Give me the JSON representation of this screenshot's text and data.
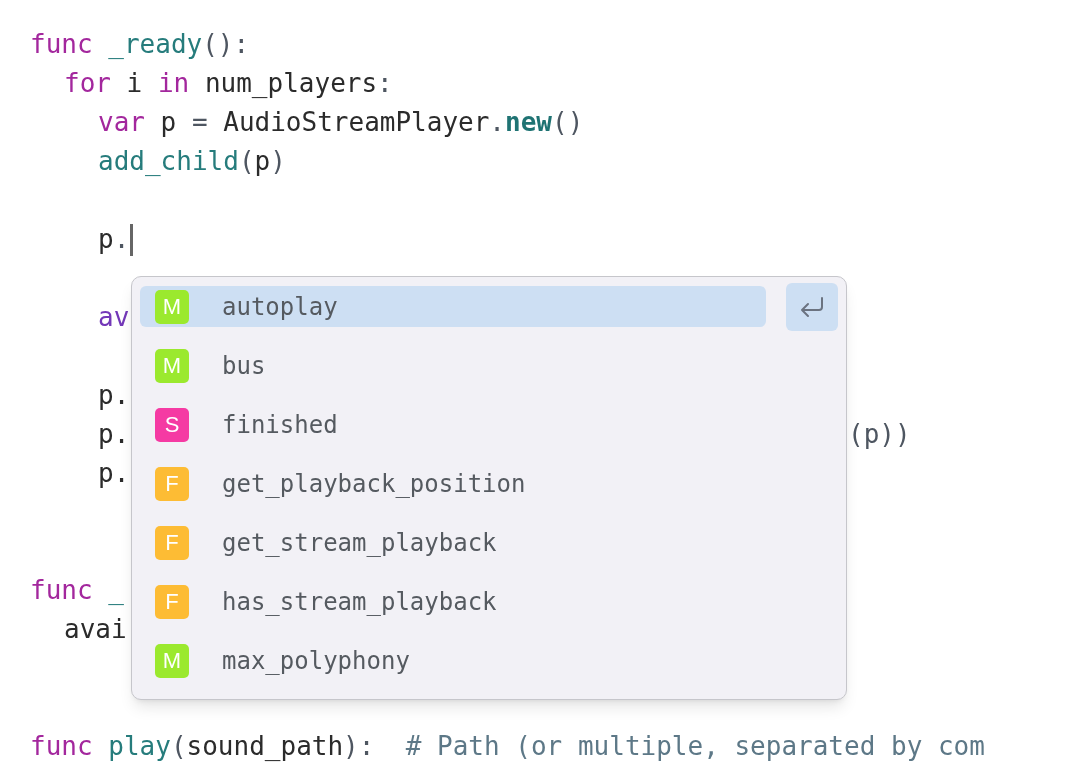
{
  "code_lines": [
    {
      "tokens": [
        {
          "kind": "keyword",
          "text": "func"
        },
        {
          "kind": "function",
          "text": " _ready"
        },
        {
          "kind": "punct",
          "text": "():"
        }
      ],
      "children": [
        {
          "tokens": [
            {
              "kind": "keyword",
              "text": "for"
            },
            {
              "kind": "plain",
              "text": " i "
            },
            {
              "kind": "keyword",
              "text": "in"
            },
            {
              "kind": "plain",
              "text": " num_players"
            },
            {
              "kind": "punct",
              "text": ":"
            }
          ],
          "children": [
            {
              "tokens": [
                {
                  "kind": "keyword",
                  "text": "var"
                },
                {
                  "kind": "plain",
                  "text": " p "
                },
                {
                  "kind": "punct",
                  "text": "="
                },
                {
                  "kind": "plain",
                  "text": " AudioStreamPlayer"
                },
                {
                  "kind": "punct",
                  "text": "."
                },
                {
                  "kind": "method",
                  "text": "new"
                },
                {
                  "kind": "punct",
                  "text": "()"
                }
              ]
            },
            {
              "tokens": [
                {
                  "kind": "function",
                  "text": "add_child"
                },
                {
                  "kind": "punct",
                  "text": "("
                },
                {
                  "kind": "plain",
                  "text": "p"
                },
                {
                  "kind": "punct",
                  "text": ")"
                }
              ]
            },
            {
              "kind": "blank"
            },
            {
              "tokens": [
                {
                  "kind": "plain",
                  "text": "p"
                },
                {
                  "kind": "punct",
                  "text": "."
                }
              ],
              "cursor": true
            },
            {
              "kind": "blank"
            },
            {
              "tokens": [
                {
                  "kind": "variable",
                  "text": "av"
                }
              ]
            },
            {
              "kind": "blank"
            },
            {
              "tokens": [
                {
                  "kind": "plain",
                  "text": "p."
                }
              ]
            },
            {
              "tokens": [
                {
                  "kind": "plain",
                  "text": "p."
                },
                {
                  "kind": "tail",
                  "text": "(p))"
                }
              ]
            },
            {
              "tokens": [
                {
                  "kind": "plain",
                  "text": "p."
                }
              ]
            }
          ]
        }
      ]
    },
    {
      "kind": "blank"
    },
    {
      "kind": "blank"
    },
    {
      "tokens": [
        {
          "kind": "keyword",
          "text": "func"
        },
        {
          "kind": "function",
          "text": " _"
        }
      ],
      "children": [
        {
          "tokens": [
            {
              "kind": "plain",
              "text": "avai"
            }
          ]
        }
      ]
    },
    {
      "kind": "blank"
    },
    {
      "kind": "blank"
    },
    {
      "tokens": [
        {
          "kind": "keyword",
          "text": "func"
        },
        {
          "kind": "function",
          "text": " play"
        },
        {
          "kind": "punct",
          "text": "("
        },
        {
          "kind": "plain",
          "text": "sound_path"
        },
        {
          "kind": "punct",
          "text": "):"
        },
        {
          "kind": "comment",
          "text": "  # Path (or multiple, separated by com"
        }
      ]
    }
  ],
  "completion_popup": {
    "items": [
      {
        "badge": "M",
        "color": "#9be92e",
        "label": "autoplay",
        "selected": true
      },
      {
        "badge": "M",
        "color": "#9be92e",
        "label": "bus",
        "selected": false
      },
      {
        "badge": "S",
        "color": "#f53aa3",
        "label": "finished",
        "selected": false
      },
      {
        "badge": "F",
        "color": "#fdbc34",
        "label": "get_playback_position",
        "selected": false
      },
      {
        "badge": "F",
        "color": "#fdbc34",
        "label": "get_stream_playback",
        "selected": false
      },
      {
        "badge": "F",
        "color": "#fdbc34",
        "label": "has_stream_playback",
        "selected": false
      },
      {
        "badge": "M",
        "color": "#9be92e",
        "label": "max_polyphony",
        "selected": false
      }
    ]
  }
}
